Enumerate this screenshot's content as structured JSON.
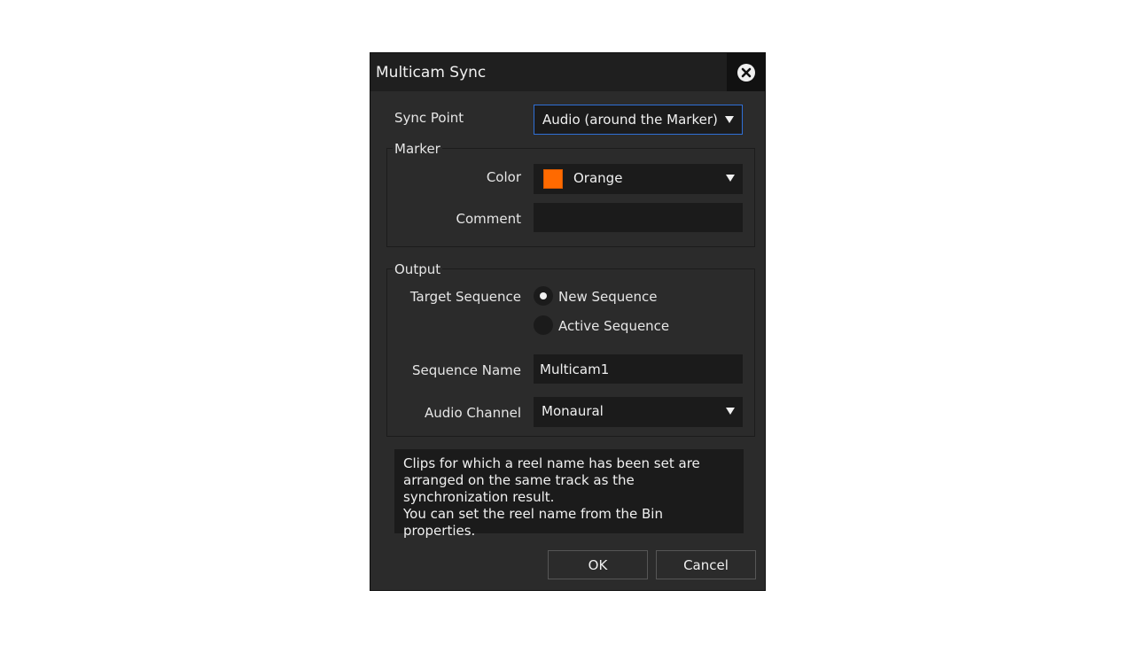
{
  "dialog": {
    "title": "Multicam Sync",
    "close_icon": "close-circle-icon"
  },
  "sync_point": {
    "label": "Sync Point",
    "value": "Audio (around the Marker)"
  },
  "marker": {
    "group_title": "Marker",
    "color_label": "Color",
    "color_value": "Orange",
    "color_hex": "#ff6a00",
    "comment_label": "Comment",
    "comment_value": ""
  },
  "output": {
    "group_title": "Output",
    "target_label": "Target Sequence",
    "option_new": "New Sequence",
    "option_active": "Active Sequence",
    "selected": "New Sequence",
    "name_label": "Sequence Name",
    "name_value": "Multicam1",
    "audio_label": "Audio Channel",
    "audio_value": "Monaural"
  },
  "info": {
    "line1": "Clips for which a reel name has been set are arranged on the same track as the synchronization result.",
    "line2": "You can set the reel name from the Bin properties."
  },
  "buttons": {
    "ok": "OK",
    "cancel": "Cancel"
  },
  "colors": {
    "accent_focus": "#2f6fd6",
    "dialog_bg": "#2b2b2b",
    "field_bg": "#1b1b1b"
  }
}
